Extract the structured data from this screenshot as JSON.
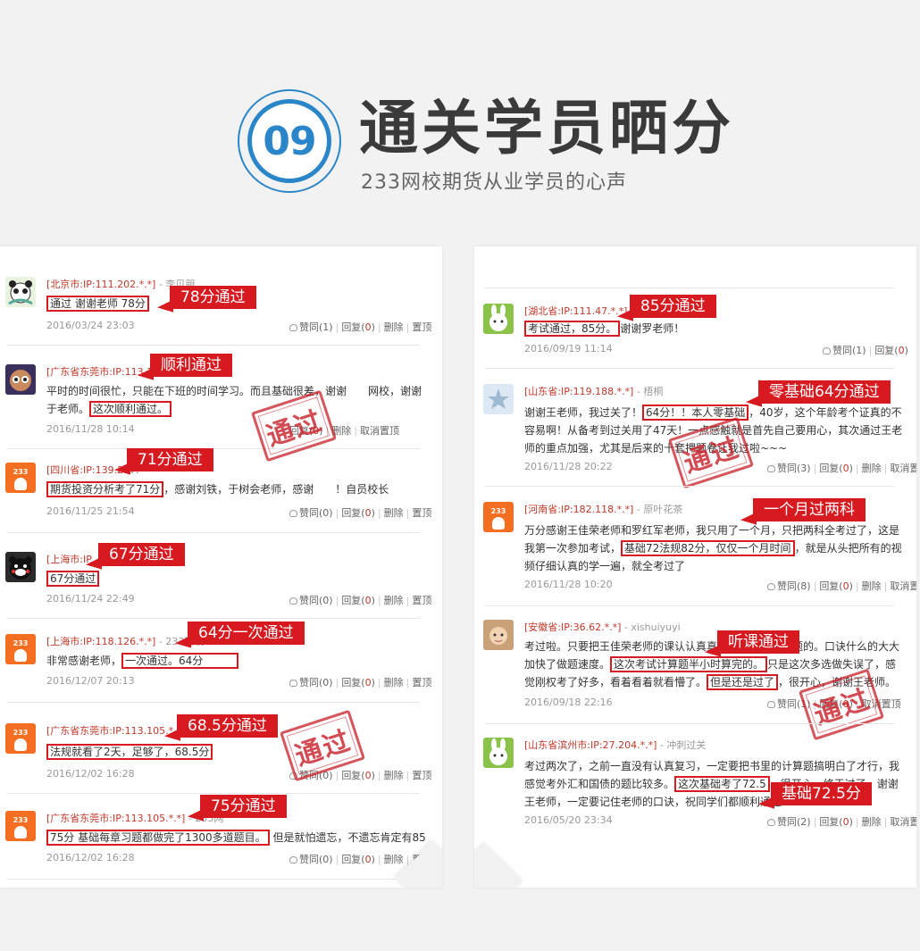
{
  "header": {
    "badge_number": "09",
    "title": "通关学员晒分",
    "subtitle": "233网校期货从业学员的心声"
  },
  "colors": {
    "accent_blue": "#2a86c8",
    "highlight_red": "#d71920",
    "meta_red": "#c0392b"
  },
  "stamp_text": "通过",
  "left_comments": [
    {
      "meta": "[北京市:IP:111.202.*.*]",
      "user": "李贝朋",
      "text_html": "<span class='hl'>通过 谢谢老师 78分</span>",
      "date": "2016/03/24 23:03",
      "like": "赞同(1)",
      "reply": "回复",
      "reply_count": "0",
      "delete": "删除",
      "pin": "置顶",
      "callout": "78分通过",
      "avatar": "panda"
    },
    {
      "meta": "[广东省东莞市:IP:113.10",
      "user": "",
      "text_html": "平时的时间很忙，只能在下班的时间学习。而且基础很差，谢谢　　网校，谢谢于老师。<span class='hl'>这次顺利通过。</span>",
      "date": "2016/11/28 10:14",
      "like": "",
      "reply": "回复",
      "reply_count": "0",
      "delete": "删除",
      "pin": "取消置顶",
      "callout": "顺利通过",
      "avatar": "face"
    },
    {
      "meta": "[四川省:IP:139.207.",
      "user": "",
      "text_html": "<span class='hl'>期货投资分析考了71分</span>，感谢刘铁，于树会老师，感谢　　！自员校长",
      "date": "2016/11/25 21:54",
      "like": "赞同(0)",
      "reply": "回复",
      "reply_count": "0",
      "delete": "删除",
      "pin": "置顶",
      "callout": "71分通过",
      "avatar": "233"
    },
    {
      "meta": "[上海市:IP",
      "user": "友",
      "text_html": "<span class='hl'>67分通过</span>",
      "date": "2016/11/24 22:49",
      "like": "赞同(0)",
      "reply": "回复",
      "reply_count": "0",
      "delete": "删除",
      "pin": "置顶",
      "callout": "67分通过",
      "avatar": "bear"
    },
    {
      "meta": "[上海市:IP:118.126.*.*]",
      "user": "233网校",
      "text_html": "非常感谢老师，<span class='hl'>一次通过。64分　　　</span>",
      "date": "2016/12/07 20:13",
      "like": "赞同(0)",
      "reply": "回复",
      "reply_count": "0",
      "delete": "删除",
      "pin": "置顶",
      "callout": "64分一次通过",
      "avatar": "233"
    },
    {
      "meta": "[广东省东莞市:IP:113.105.*.*]",
      "user": "",
      "text_html": "<span class='hl'>法规就看了2天，足够了，68.5分</span>",
      "date": "2016/12/02 16:28",
      "like": "赞同(0)",
      "reply": "回复",
      "reply_count": "0",
      "delete": "删除",
      "pin": "置顶",
      "callout": "68.5分通过",
      "avatar": "233"
    },
    {
      "meta": "[广东省东莞市:IP:113.105.*.*]",
      "user": "233网",
      "text_html": "<span class='hl'>75分 基础每章习题都做完了1300多道题目。</span> 但是就怕遗忘，不遗忘肯定有85",
      "date": "2016/12/02 16:28",
      "like": "赞同(0)",
      "reply": "回复",
      "reply_count": "0",
      "delete": "删除",
      "pin": "置顶",
      "callout": "75分通过",
      "avatar": "233"
    }
  ],
  "right_comments": [
    {
      "meta": "[湖北省:IP:111.47.*.*]",
      "user": "",
      "text_html": "<span class='hl'>考试通过，85分。</span>谢谢罗老师！",
      "date": "2016/09/19 11:14",
      "like": "赞同(1)",
      "reply": "回复",
      "reply_count": "0",
      "delete": "",
      "pin": "",
      "callout": "85分通过",
      "avatar": "rabbit"
    },
    {
      "meta": "[山东省:IP:119.188.*.*]",
      "user": "梧桐",
      "text_html": "谢谢王老师，我过关了！<span class='hl'>64分！！本人零基础</span>，40岁，这个年龄考个证真的不容易啊！从备考到过关用了47天！一点感触就是首先自己要用心，其次通过王老师的重点加强，尤其是后来的十套押题卷让我过啦~~~",
      "date": "2016/11/28 20:22",
      "like": "赞同(3)",
      "reply": "回复",
      "reply_count": "0",
      "delete": "删除",
      "pin": "取消置顶",
      "callout": "零基础64分通过",
      "avatar": "star"
    },
    {
      "meta": "[河南省:IP:182.118.*.*]",
      "user": "原叶花茶",
      "text_html": "万分感谢王佳荣老师和罗红军老师，我只用了一个月，只把两科全考过了，这是我第一次参加考试，<span class='hl'>基础72法规82分，仅仅一个月时间</span>，就是从头把所有的视频仔细认真的学一遍，就全考过了",
      "date": "2016/11/28 10:20",
      "like": "赞同(8)",
      "reply": "回复",
      "reply_count": "0",
      "delete": "删除",
      "pin": "取消置顶",
      "callout": "一个月过两科",
      "avatar": "233"
    },
    {
      "meta": "[安徽省:IP:36.62.*.*]",
      "user": "xishuiyuyi",
      "text_html": "考过啦。只要把王佳荣老师的课认认真真听完，基本没问题的。口诀什么的大大加快了做题速度。<span class='hl'>这次考试计算题半小时算完的。</span>只是这次多选做失误了，感觉刚权考了好多，看着看着就看懵了。<span class='hl'>但是还是过了</span>，很开心，谢谢王老师。",
      "date": "2016/09/18 22:16",
      "like": "赞同(1)",
      "reply": "回复",
      "reply_count": "0",
      "delete": "",
      "pin": "取消置顶",
      "callout": "听课通过",
      "avatar": "baby"
    },
    {
      "meta": "[山东省滨州市:IP:27.204.*.*]",
      "user": "冲刺过关",
      "text_html": "考过两次了，之前一直没有认真复习，一定要把书里的计算题搞明白了才行，我感觉考外汇和国债的题比较多。<span class='hl'>这次基础考了72.5</span>，很开心，终于过了，谢谢王老师，一定要记住老师的口诀，祝同学们都顺利通过",
      "date": "2016/05/20 23:34",
      "like": "赞同(2)",
      "reply": "回复",
      "reply_count": "0",
      "delete": "删除",
      "pin": "取消置顶",
      "callout": "基础72.5分",
      "avatar": "rabbit"
    }
  ]
}
